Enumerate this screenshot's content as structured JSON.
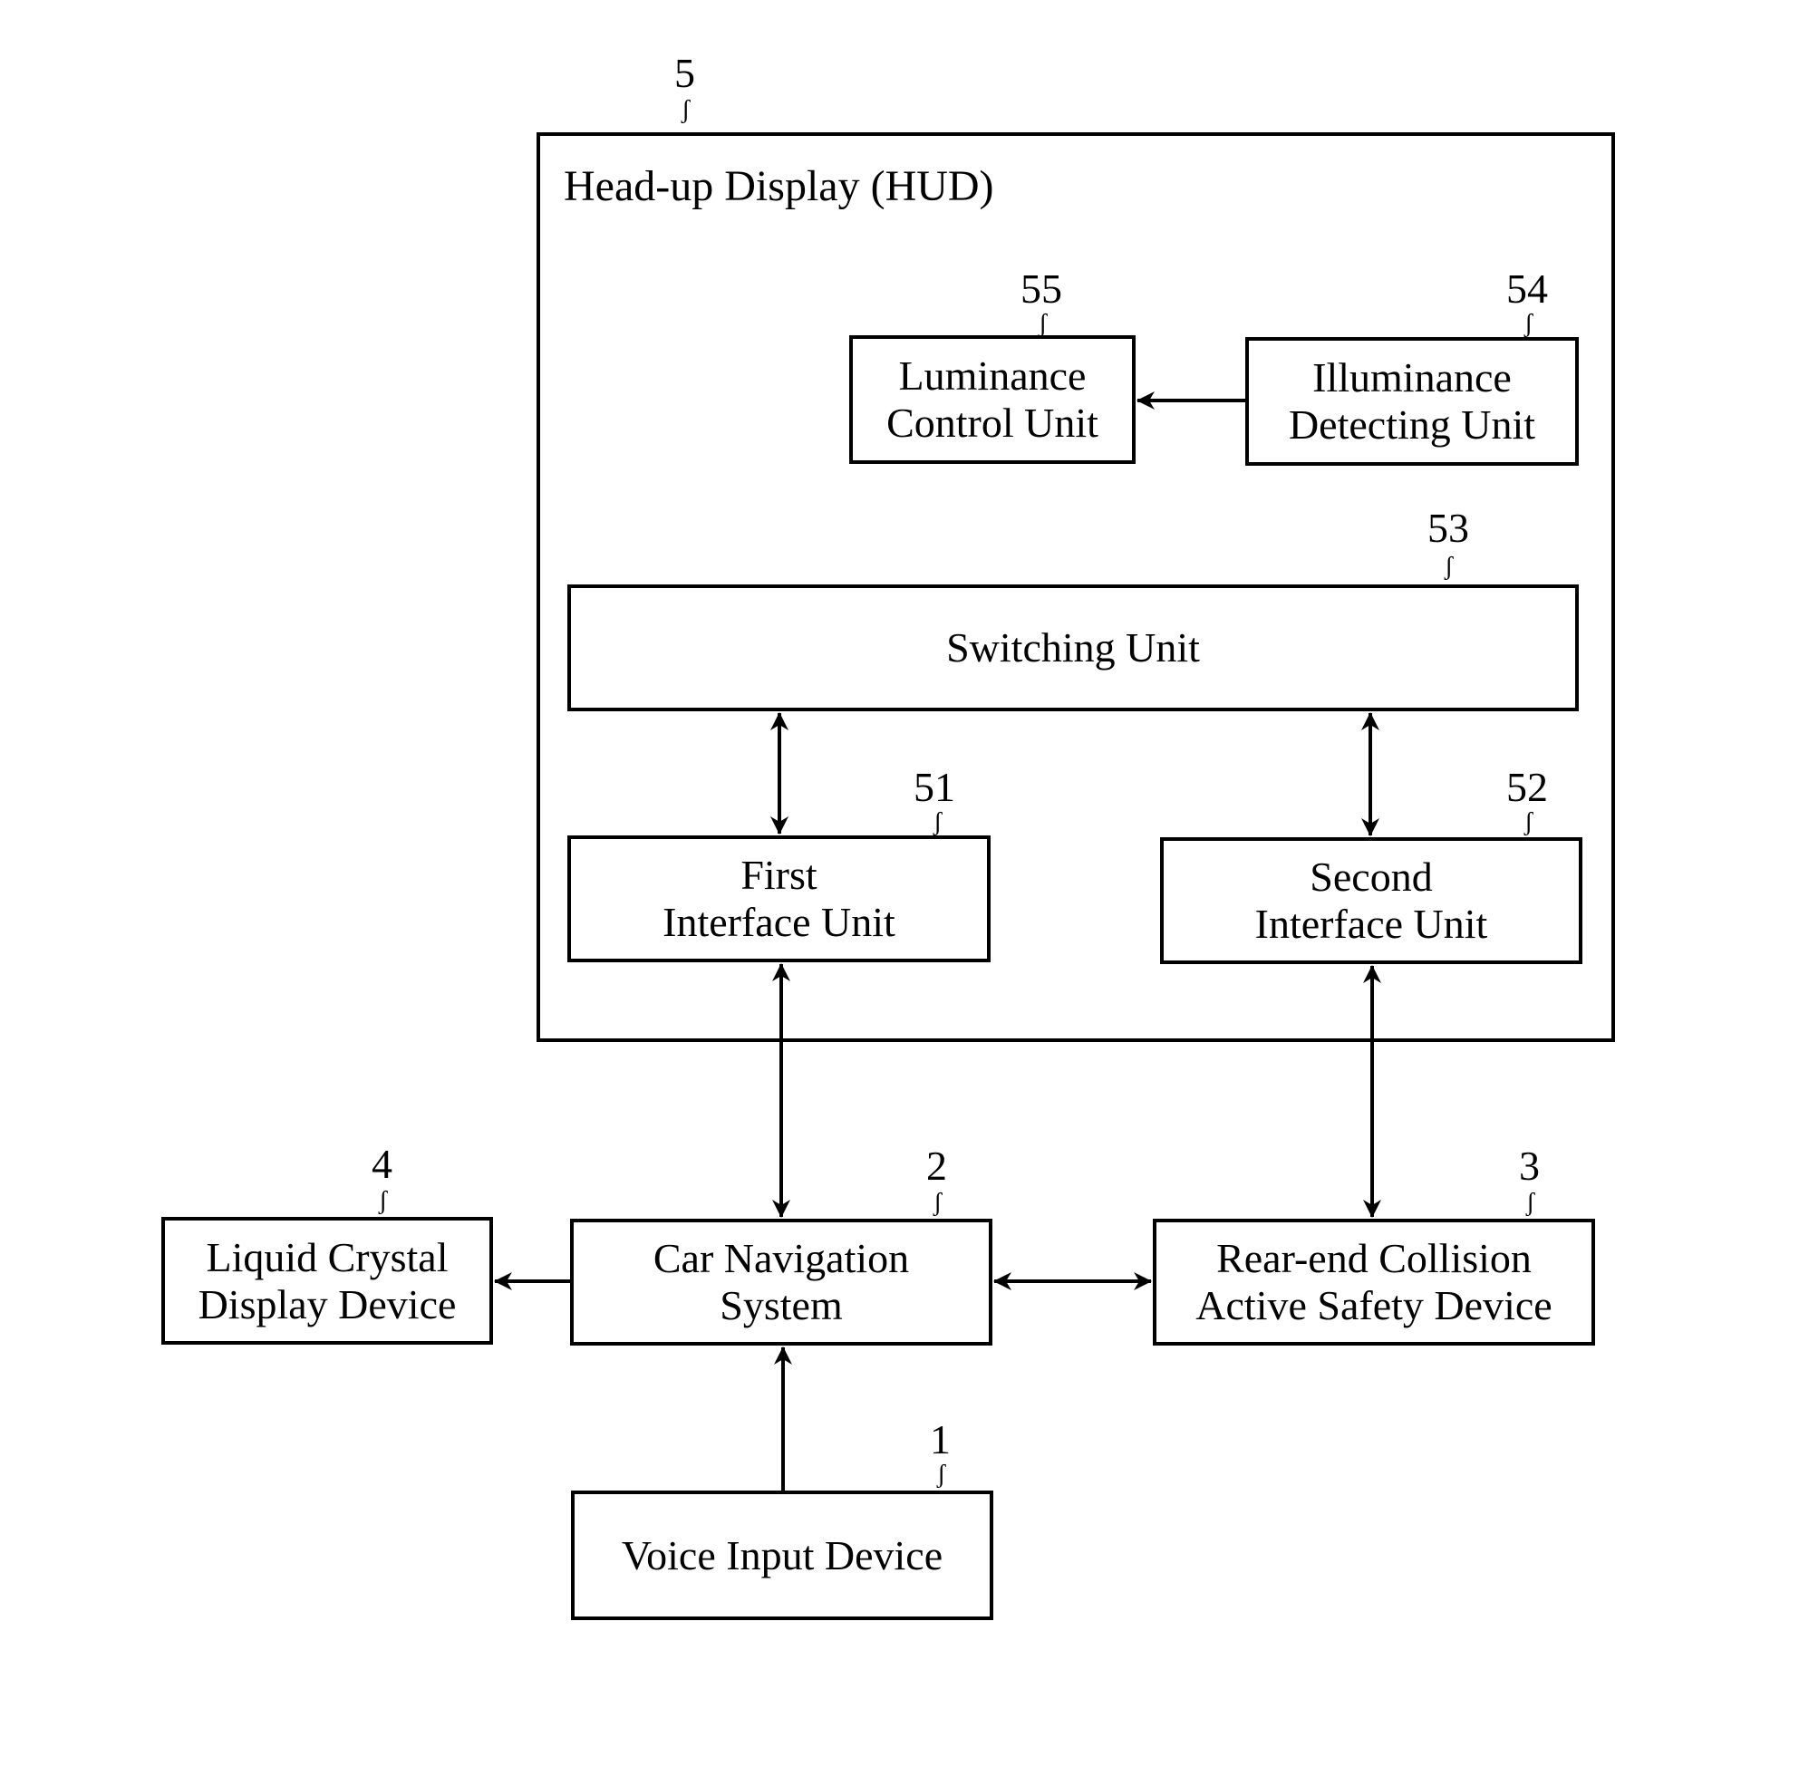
{
  "diagram": {
    "hud": {
      "ref": "5",
      "title": "Head-up Display (HUD)"
    },
    "blocks": {
      "luminance": {
        "ref": "55",
        "lines": [
          "Luminance",
          "Control Unit"
        ]
      },
      "illuminance": {
        "ref": "54",
        "lines": [
          "Illuminance",
          "Detecting Unit"
        ]
      },
      "switching": {
        "ref": "53",
        "lines": [
          "Switching Unit"
        ]
      },
      "first_interface": {
        "ref": "51",
        "lines": [
          "First",
          "Interface Unit"
        ]
      },
      "second_interface": {
        "ref": "52",
        "lines": [
          "Second",
          "Interface Unit"
        ]
      },
      "car_navigation": {
        "ref": "2",
        "lines": [
          "Car Navigation",
          "System"
        ]
      },
      "lcd": {
        "ref": "4",
        "lines": [
          "Liquid Crystal",
          "Display Device"
        ]
      },
      "rear_end": {
        "ref": "3",
        "lines": [
          "Rear-end Collision",
          "Active Safety Device"
        ]
      },
      "voice_input": {
        "ref": "1",
        "lines": [
          "Voice Input Device"
        ]
      }
    },
    "connections": [
      {
        "from": "illuminance",
        "to": "luminance",
        "direction": "one-way"
      },
      {
        "from": "switching",
        "to": "first_interface",
        "direction": "two-way"
      },
      {
        "from": "switching",
        "to": "second_interface",
        "direction": "two-way"
      },
      {
        "from": "first_interface",
        "to": "car_navigation",
        "direction": "two-way"
      },
      {
        "from": "second_interface",
        "to": "rear_end",
        "direction": "two-way"
      },
      {
        "from": "car_navigation",
        "to": "lcd",
        "direction": "one-way"
      },
      {
        "from": "car_navigation",
        "to": "rear_end",
        "direction": "two-way"
      },
      {
        "from": "voice_input",
        "to": "car_navigation",
        "direction": "one-way"
      }
    ],
    "leader_glyph": "ʃ"
  }
}
